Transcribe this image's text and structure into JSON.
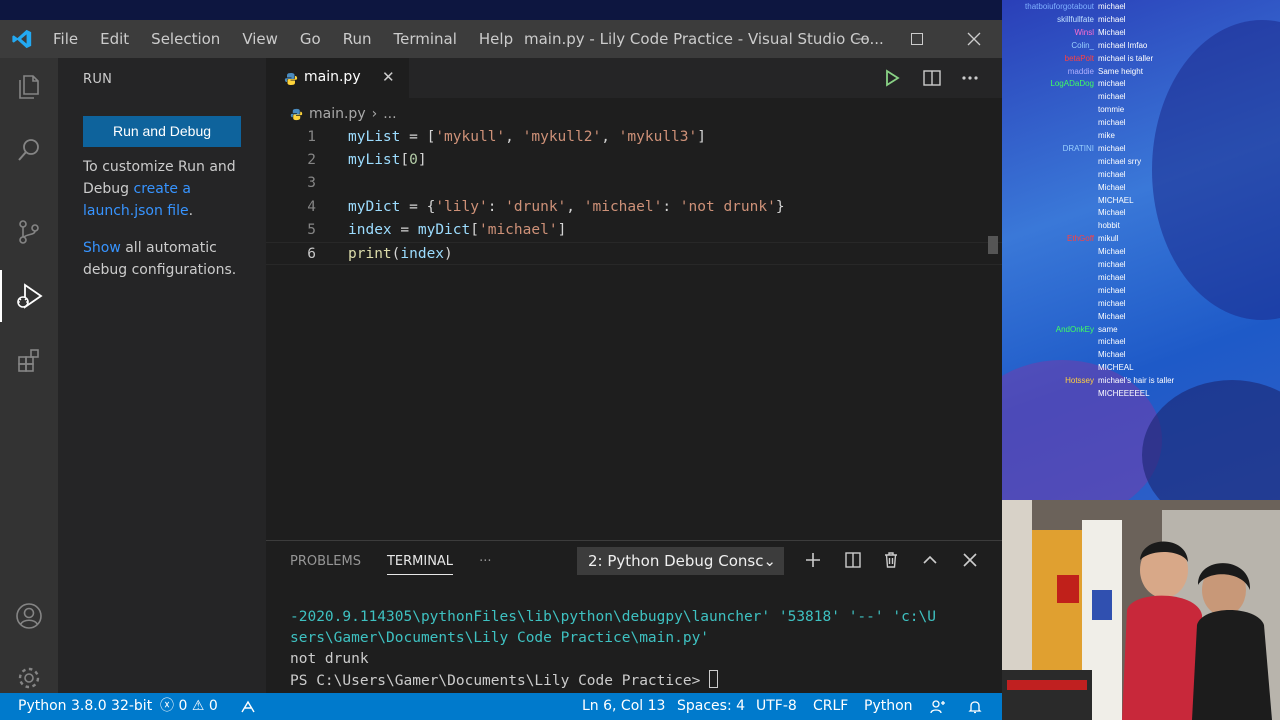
{
  "titlebar": {
    "menu": [
      "File",
      "Edit",
      "Selection",
      "View",
      "Go",
      "Run",
      "Terminal",
      "Help"
    ],
    "title": "main.py - Lily Code Practice - Visual Studio Co..."
  },
  "sidebar": {
    "header": "RUN",
    "run_button": "Run and Debug",
    "customize_text": "To customize Run and Debug ",
    "customize_link": "create a launch.json file",
    "customize_end": ".",
    "show_link": "Show",
    "show_text": " all automatic debug configurations."
  },
  "editor": {
    "tab_label": "main.py",
    "breadcrumb_file": "main.py",
    "breadcrumb_more": "...",
    "lines": [
      {
        "num": "1",
        "text": "myList = ['mykull', 'mykull2', 'mykull3']"
      },
      {
        "num": "2",
        "text": "myList[0]"
      },
      {
        "num": "3",
        "text": ""
      },
      {
        "num": "4",
        "text": "myDict = {'lily': 'drunk', 'michael': 'not drunk'}"
      },
      {
        "num": "5",
        "text": "index = myDict['michael']"
      },
      {
        "num": "6",
        "text": "print(index)"
      }
    ]
  },
  "panel": {
    "tabs": [
      "PROBLEMS",
      "TERMINAL"
    ],
    "more": "···",
    "terminal_select": "2: Python Debug Consc",
    "terminal_lines": [
      "-2020.9.114305\\pythonFiles\\lib\\python\\debugpy\\launcher' '53818' '--' 'c:\\U",
      "sers\\Gamer\\Documents\\Lily Code Practice\\main.py'",
      "not drunk",
      "PS C:\\Users\\Gamer\\Documents\\Lily Code Practice> "
    ]
  },
  "statusbar": {
    "python": "Python 3.8.0 32-bit",
    "errors": "0",
    "warnings": "0",
    "position": "Ln 6, Col 13",
    "spaces": "Spaces: 4",
    "encoding": "UTF-8",
    "eol": "CRLF",
    "language": "Python"
  },
  "chat": [
    {
      "user": "thatboiuforgotabout",
      "text": "michael",
      "color": "#7fb0ff"
    },
    {
      "user": "skillfullfate",
      "text": "michael",
      "color": "#c0e0ff"
    },
    {
      "user": "Winsl",
      "text": "Michael",
      "color": "#ff6fd0"
    },
    {
      "user": "Colin_",
      "text": "michael lmfao",
      "color": "#9ad0ff"
    },
    {
      "user": "betaPolt",
      "text": "michael is taller",
      "color": "#ff4040"
    },
    {
      "user": "maddie",
      "text": "Same height",
      "color": "#b0b0ff"
    },
    {
      "user": "LogADaDog",
      "text": "michael",
      "color": "#40ff60"
    },
    {
      "user": "",
      "text": "michael",
      "color": "#9ad0ff"
    },
    {
      "user": "",
      "text": "tommie",
      "color": "#40c040"
    },
    {
      "user": "",
      "text": "michael",
      "color": "#9ad0ff"
    },
    {
      "user": "",
      "text": "mike",
      "color": "#9ad0ff"
    },
    {
      "user": "DRATINI",
      "text": "michael",
      "color": "#9ad0ff"
    },
    {
      "user": "",
      "text": "michael srry",
      "color": "#9ad0ff"
    },
    {
      "user": "",
      "text": "michael",
      "color": "#ff80c0"
    },
    {
      "user": "",
      "text": "Michael",
      "color": "#ff4040"
    },
    {
      "user": "",
      "text": "MICHAEL",
      "color": "#9ad0ff"
    },
    {
      "user": "",
      "text": "Michael",
      "color": "#9ad0ff"
    },
    {
      "user": "",
      "text": "hobbit",
      "color": "#9ad0ff"
    },
    {
      "user": "EthGoff",
      "text": "mikull",
      "color": "#ff4040"
    },
    {
      "user": "",
      "text": "Michael",
      "color": "#ff4040"
    },
    {
      "user": "",
      "text": "michael",
      "color": "#9ad0ff"
    },
    {
      "user": "",
      "text": "michael",
      "color": "#40c040"
    },
    {
      "user": "",
      "text": "michael",
      "color": "#9ad0ff"
    },
    {
      "user": "",
      "text": "michael",
      "color": "#9ad0ff"
    },
    {
      "user": "",
      "text": "Michael",
      "color": "#9ad0ff"
    },
    {
      "user": "AndOnkEy",
      "text": "same",
      "color": "#40ff60"
    },
    {
      "user": "",
      "text": "michael",
      "color": "#9ad0ff"
    },
    {
      "user": "",
      "text": "Michael",
      "color": "#9ad0ff"
    },
    {
      "user": "",
      "text": "MICHEAL",
      "color": "#9ad0ff"
    },
    {
      "user": "Hotssey",
      "text": "michael's hair is taller",
      "color": "#ffd040"
    },
    {
      "user": "",
      "text": "MICHEEEEEL",
      "color": "#9ad0ff"
    }
  ]
}
